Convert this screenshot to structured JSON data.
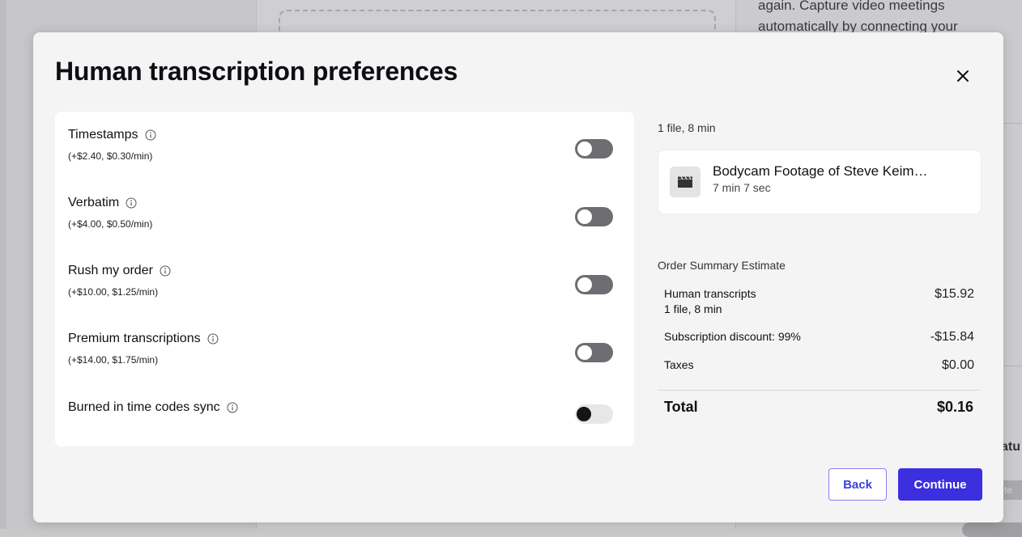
{
  "background": {
    "side_text": [
      "again. Capture video meetings",
      "automatically by connecting your"
    ],
    "fragment_text": "atu",
    "chip_text": "te"
  },
  "modal": {
    "title": "Human transcription preferences",
    "close_icon": "close-icon"
  },
  "options": [
    {
      "label": "Timestamps",
      "price": "(+$2.40, $0.30/min)",
      "enabled": false
    },
    {
      "label": "Verbatim",
      "price": "(+$4.00, $0.50/min)",
      "enabled": false
    },
    {
      "label": "Rush my order",
      "price": "(+$10.00, $1.25/min)",
      "enabled": false
    },
    {
      "label": "Premium transcriptions",
      "price": "(+$14.00, $1.75/min)",
      "enabled": false
    },
    {
      "label": "Burned in time codes sync",
      "price": "",
      "enabled": false
    }
  ],
  "file_summary": "1 file, 8 min",
  "file": {
    "icon": "clapperboard-icon",
    "name": "Bodycam Footage of Steve Keim…",
    "duration": "7 min 7 sec"
  },
  "order_summary": {
    "heading": "Order Summary Estimate",
    "lines": [
      {
        "label": "Human transcripts",
        "sublabel": "1 file, 8 min",
        "amount": "$15.92"
      },
      {
        "label": "Subscription discount: 99%",
        "sublabel": "",
        "amount": "-$15.84"
      },
      {
        "label": "Taxes",
        "sublabel": "",
        "amount": "$0.00"
      }
    ],
    "total_label": "Total",
    "total_amount": "$0.16"
  },
  "buttons": {
    "back": "Back",
    "continue": "Continue"
  },
  "colors": {
    "primary": "#3b2fe0",
    "toggle_off": "#6d6d72",
    "modal_bg": "#f4f4f5"
  }
}
